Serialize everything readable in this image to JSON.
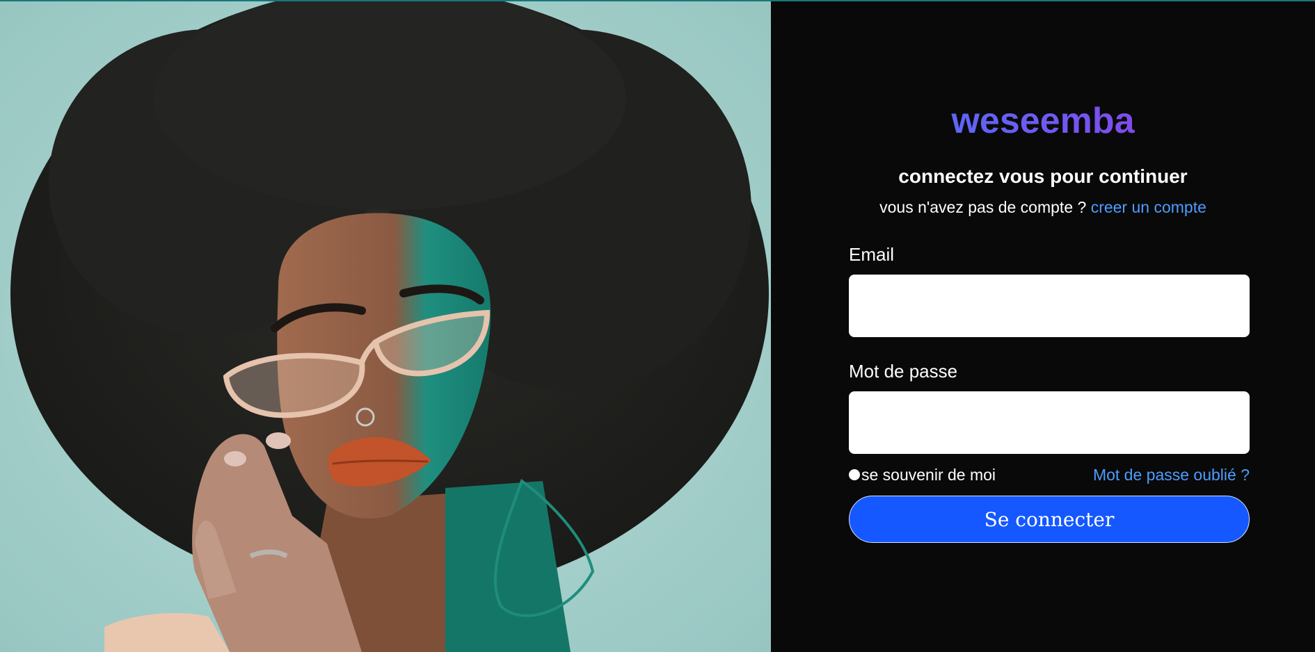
{
  "colors": {
    "panel_background": "#090909",
    "accent_link": "#4c9dff",
    "button_background": "#1558ff",
    "logo_gradient": [
      "#3d7bff",
      "#6d5bf2",
      "#a42bdc"
    ]
  },
  "hero_image": {
    "icon": "portrait-photo-icon",
    "description_hidden": true
  },
  "brand": {
    "logo_text": "weseemba"
  },
  "header": {
    "title": "connectez vous pour continuer",
    "no_account_text": "vous n'avez pas de compte ?",
    "create_account_link": "creer un compte"
  },
  "form": {
    "email": {
      "label": "Email",
      "value": "",
      "placeholder": ""
    },
    "password": {
      "label": "Mot de passe",
      "value": "",
      "placeholder": ""
    },
    "remember_me": {
      "label": "se souvenir de moi",
      "checked": false
    },
    "forgot_password_link": "Mot de passe oublié ?",
    "submit_label": "Se connecter"
  }
}
